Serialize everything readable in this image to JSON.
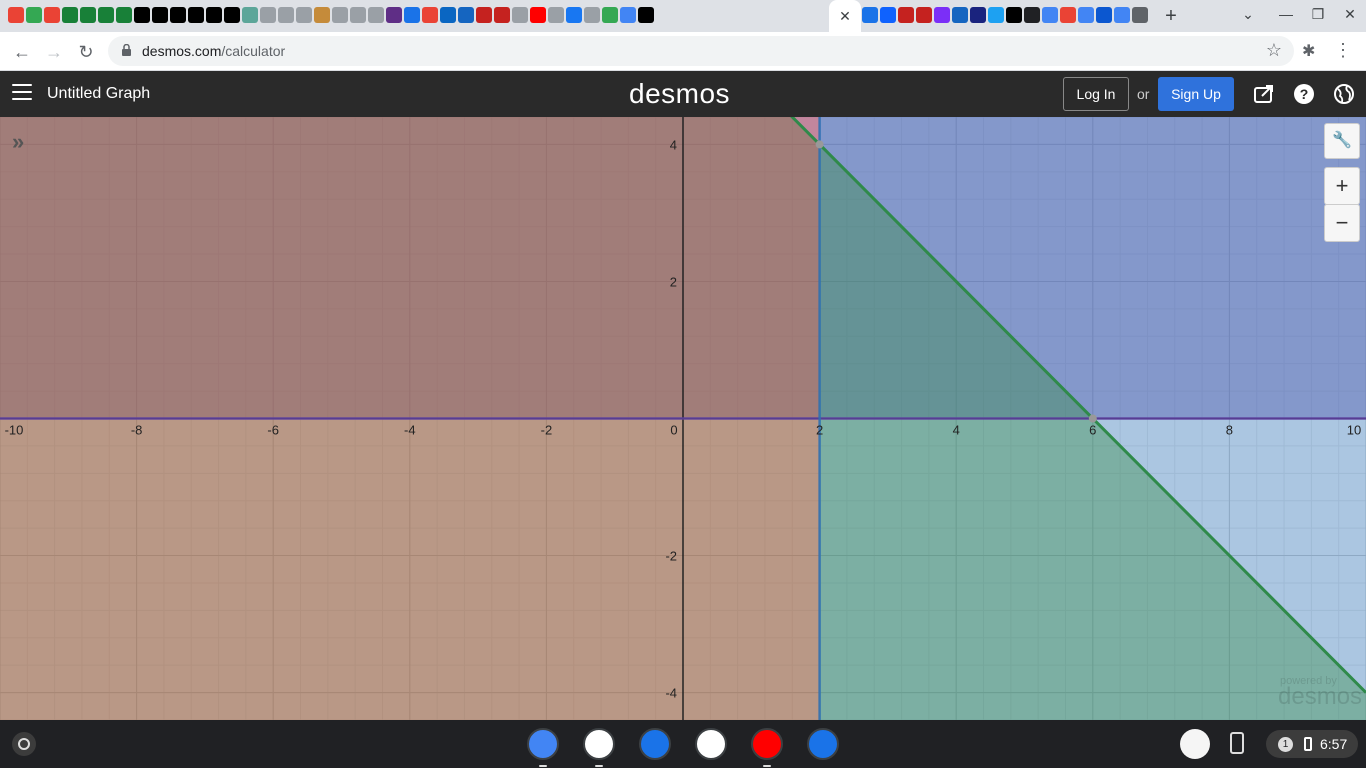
{
  "browser": {
    "url_host": "desmos.com",
    "url_path": "/calculator",
    "active_tab_close": "✕",
    "new_tab": "+",
    "tab_favicon_colors": [
      "#ea4335",
      "#34a853",
      "#ea4335",
      "#188038",
      "#188038",
      "#188038",
      "#188038",
      "#000000",
      "#000000",
      "#000000",
      "#000000",
      "#000000",
      "#000000",
      "#5ca699",
      "#9aa0a6",
      "#9aa0a6",
      "#9aa0a6",
      "#c58b3a",
      "#9aa0a6",
      "#9aa0a6",
      "#9aa0a6",
      "#5f2e86",
      "#1a73e8",
      "#ea4335",
      "#0a66c2",
      "#1565c0",
      "#c5221f",
      "#c5221f",
      "#9aa0a6",
      "#ff0000",
      "#9aa0a6",
      "#1877f2",
      "#9aa0a6",
      "#34a853",
      "#4285f4",
      "#000000"
    ],
    "tab_favicon_colors_2": [
      "#1a73e8",
      "#0f62fe",
      "#c5221f",
      "#c5221f",
      "#7b2ff7",
      "#1565c0",
      "#1a237e",
      "#1da1f2",
      "#000000",
      "#202124",
      "#4285f4",
      "#ea4335",
      "#4285f4",
      "#0b57d0",
      "#4285f4",
      "#5f6368"
    ]
  },
  "desmos": {
    "graph_title": "Untitled Graph",
    "logo": "desmos",
    "login_label": "Log In",
    "or_label": "or",
    "signup_label": "Sign Up",
    "zoom_in": "+",
    "zoom_out": "−",
    "expand_icon": "»",
    "powered_by": "powered by",
    "powered_logo": "desmos"
  },
  "graph": {
    "x_range": [
      -10,
      10
    ],
    "y_range": [
      -4.4,
      4.4
    ],
    "x_tick_labels": [
      "-10",
      "-8",
      "-6",
      "-4",
      "-2",
      "0",
      "2",
      "4",
      "6",
      "8",
      "10"
    ],
    "x_tick_values": [
      -10,
      -8,
      -6,
      -4,
      -2,
      0,
      2,
      4,
      6,
      8,
      10
    ],
    "y_tick_labels": [
      "4",
      "2",
      "-2",
      "-4"
    ],
    "y_tick_values": [
      4,
      2,
      -2,
      -4
    ],
    "regions": [
      {
        "name": "y ≥ 0",
        "color": "#6042a6"
      },
      {
        "name": "x ≥ 2",
        "color": "#2d70b3"
      },
      {
        "name": "y ≤ -x + 6",
        "color": "#388c46"
      },
      {
        "name": "x ≤ 2",
        "color": "#c74440"
      }
    ],
    "boundary_line_color": "#2f8a4a",
    "points": [
      {
        "x": 2,
        "y": 4
      },
      {
        "x": 6,
        "y": 0
      }
    ]
  },
  "shelf": {
    "time": "6:57",
    "notification_count": "1",
    "apps": [
      {
        "name": "chrome",
        "color": "#4285f4"
      },
      {
        "name": "gmail",
        "color": "#ffffff"
      },
      {
        "name": "files",
        "color": "#1a73e8"
      },
      {
        "name": "meet",
        "color": "#ffffff"
      },
      {
        "name": "youtube",
        "color": "#ff0000"
      },
      {
        "name": "messages",
        "color": "#1a73e8"
      }
    ]
  }
}
